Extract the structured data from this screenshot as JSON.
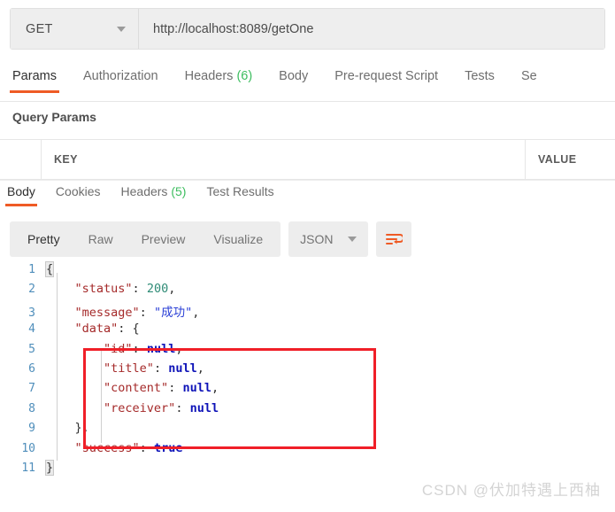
{
  "request": {
    "method": "GET",
    "method_caret_icon": "chevron-down-icon",
    "url": "http://localhost:8089/getOne",
    "tabs": [
      {
        "label": "Params",
        "active": true,
        "count": ""
      },
      {
        "label": "Authorization",
        "active": false,
        "count": ""
      },
      {
        "label": "Headers",
        "active": false,
        "count": "(6)"
      },
      {
        "label": "Body",
        "active": false,
        "count": ""
      },
      {
        "label": "Pre-request Script",
        "active": false,
        "count": ""
      },
      {
        "label": "Tests",
        "active": false,
        "count": ""
      },
      {
        "label": "Se",
        "active": false,
        "count": ""
      }
    ],
    "section_title": "Query Params",
    "table": {
      "columns": [
        "KEY",
        "VALUE"
      ],
      "rows": []
    }
  },
  "response": {
    "tabs": [
      {
        "label": "Body",
        "active": true,
        "count": ""
      },
      {
        "label": "Cookies",
        "active": false,
        "count": ""
      },
      {
        "label": "Headers",
        "active": false,
        "count": "(5)"
      },
      {
        "label": "Test Results",
        "active": false,
        "count": ""
      }
    ],
    "view_modes": [
      {
        "label": "Pretty",
        "active": true
      },
      {
        "label": "Raw",
        "active": false
      },
      {
        "label": "Preview",
        "active": false
      },
      {
        "label": "Visualize",
        "active": false
      }
    ],
    "format": "JSON",
    "format_caret_icon": "chevron-down-icon",
    "wrap_icon": "wrap-lines-icon",
    "accent_color": "#ef5b25",
    "body_lines": [
      {
        "n": "1",
        "tokens": [
          {
            "t": "{",
            "c": "brace-hl"
          }
        ]
      },
      {
        "n": "2",
        "tokens": [
          {
            "t": "    ",
            "c": "pn"
          },
          {
            "t": "\"status\"",
            "c": "k"
          },
          {
            "t": ": ",
            "c": "pn"
          },
          {
            "t": "200",
            "c": "num"
          },
          {
            "t": ",",
            "c": "pn"
          }
        ]
      },
      {
        "n": "3",
        "tokens": [
          {
            "t": "    ",
            "c": "pn"
          },
          {
            "t": "\"message\"",
            "c": "k"
          },
          {
            "t": ": ",
            "c": "pn"
          },
          {
            "t": "\"成功\"",
            "c": "str"
          },
          {
            "t": ",",
            "c": "pn"
          }
        ]
      },
      {
        "n": "4",
        "tokens": [
          {
            "t": "    ",
            "c": "pn"
          },
          {
            "t": "\"data\"",
            "c": "k"
          },
          {
            "t": ": {",
            "c": "pn"
          }
        ]
      },
      {
        "n": "5",
        "tokens": [
          {
            "t": "        ",
            "c": "pn"
          },
          {
            "t": "\"id\"",
            "c": "k"
          },
          {
            "t": ": ",
            "c": "pn"
          },
          {
            "t": "null",
            "c": "kw"
          },
          {
            "t": ",",
            "c": "pn"
          }
        ]
      },
      {
        "n": "6",
        "tokens": [
          {
            "t": "        ",
            "c": "pn"
          },
          {
            "t": "\"title\"",
            "c": "k"
          },
          {
            "t": ": ",
            "c": "pn"
          },
          {
            "t": "null",
            "c": "kw"
          },
          {
            "t": ",",
            "c": "pn"
          }
        ]
      },
      {
        "n": "7",
        "tokens": [
          {
            "t": "        ",
            "c": "pn"
          },
          {
            "t": "\"content\"",
            "c": "k"
          },
          {
            "t": ": ",
            "c": "pn"
          },
          {
            "t": "null",
            "c": "kw"
          },
          {
            "t": ",",
            "c": "pn"
          }
        ]
      },
      {
        "n": "8",
        "tokens": [
          {
            "t": "        ",
            "c": "pn"
          },
          {
            "t": "\"receiver\"",
            "c": "k"
          },
          {
            "t": ": ",
            "c": "pn"
          },
          {
            "t": "null",
            "c": "kw"
          }
        ]
      },
      {
        "n": "9",
        "tokens": [
          {
            "t": "    },",
            "c": "pn"
          }
        ]
      },
      {
        "n": "10",
        "tokens": [
          {
            "t": "    ",
            "c": "pn"
          },
          {
            "t": "\"success\"",
            "c": "k"
          },
          {
            "t": ": ",
            "c": "pn"
          },
          {
            "t": "true",
            "c": "kw"
          }
        ]
      },
      {
        "n": "11",
        "tokens": [
          {
            "t": "}",
            "c": "brace-hl"
          }
        ]
      }
    ]
  },
  "annotation": {
    "box_color": "#f01f28"
  },
  "watermark": "CSDN @伏加特遇上西柚"
}
